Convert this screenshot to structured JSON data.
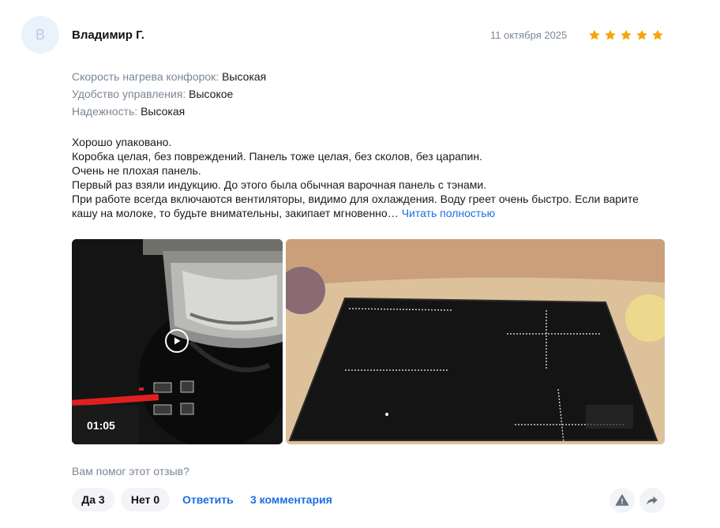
{
  "review": {
    "avatar_letter": "В",
    "author": "Владимир Г.",
    "date": "11 октября 2025",
    "rating": 5,
    "star_color": "#f7a307",
    "params": [
      {
        "label": "Скорость нагрева конфорок:",
        "value": "Высокая"
      },
      {
        "label": "Удобство управления:",
        "value": "Высокое"
      },
      {
        "label": "Надежность:",
        "value": "Высокая"
      }
    ],
    "text_lines": [
      "Хорошо упаковано.",
      "Коробка целая, без повреждений. Панель тоже целая, без сколов, без царапин.",
      "Очень не плохая панель.",
      "Первый раз взяли индукцию. До этого была обычная варочная панель с тэнами.",
      "При работе всегда включаются вентиляторы, видимо для охлаждения. Воду греет очень быстро. Если варите",
      "кашу на молоке, то будьте внимательны, закипает мгновенно…"
    ],
    "read_more": "Читать полностью",
    "media": {
      "video_duration": "01:05",
      "video_icon": "play-icon"
    },
    "footer": {
      "helpful_question": "Вам помог этот отзыв?",
      "yes_label": "Да 3",
      "no_label": "Нет 0",
      "reply_label": "Ответить",
      "comments_label": "3 комментария",
      "report_icon": "warning-icon",
      "share_icon": "share-icon"
    },
    "link_color": "#1d6fe0"
  }
}
